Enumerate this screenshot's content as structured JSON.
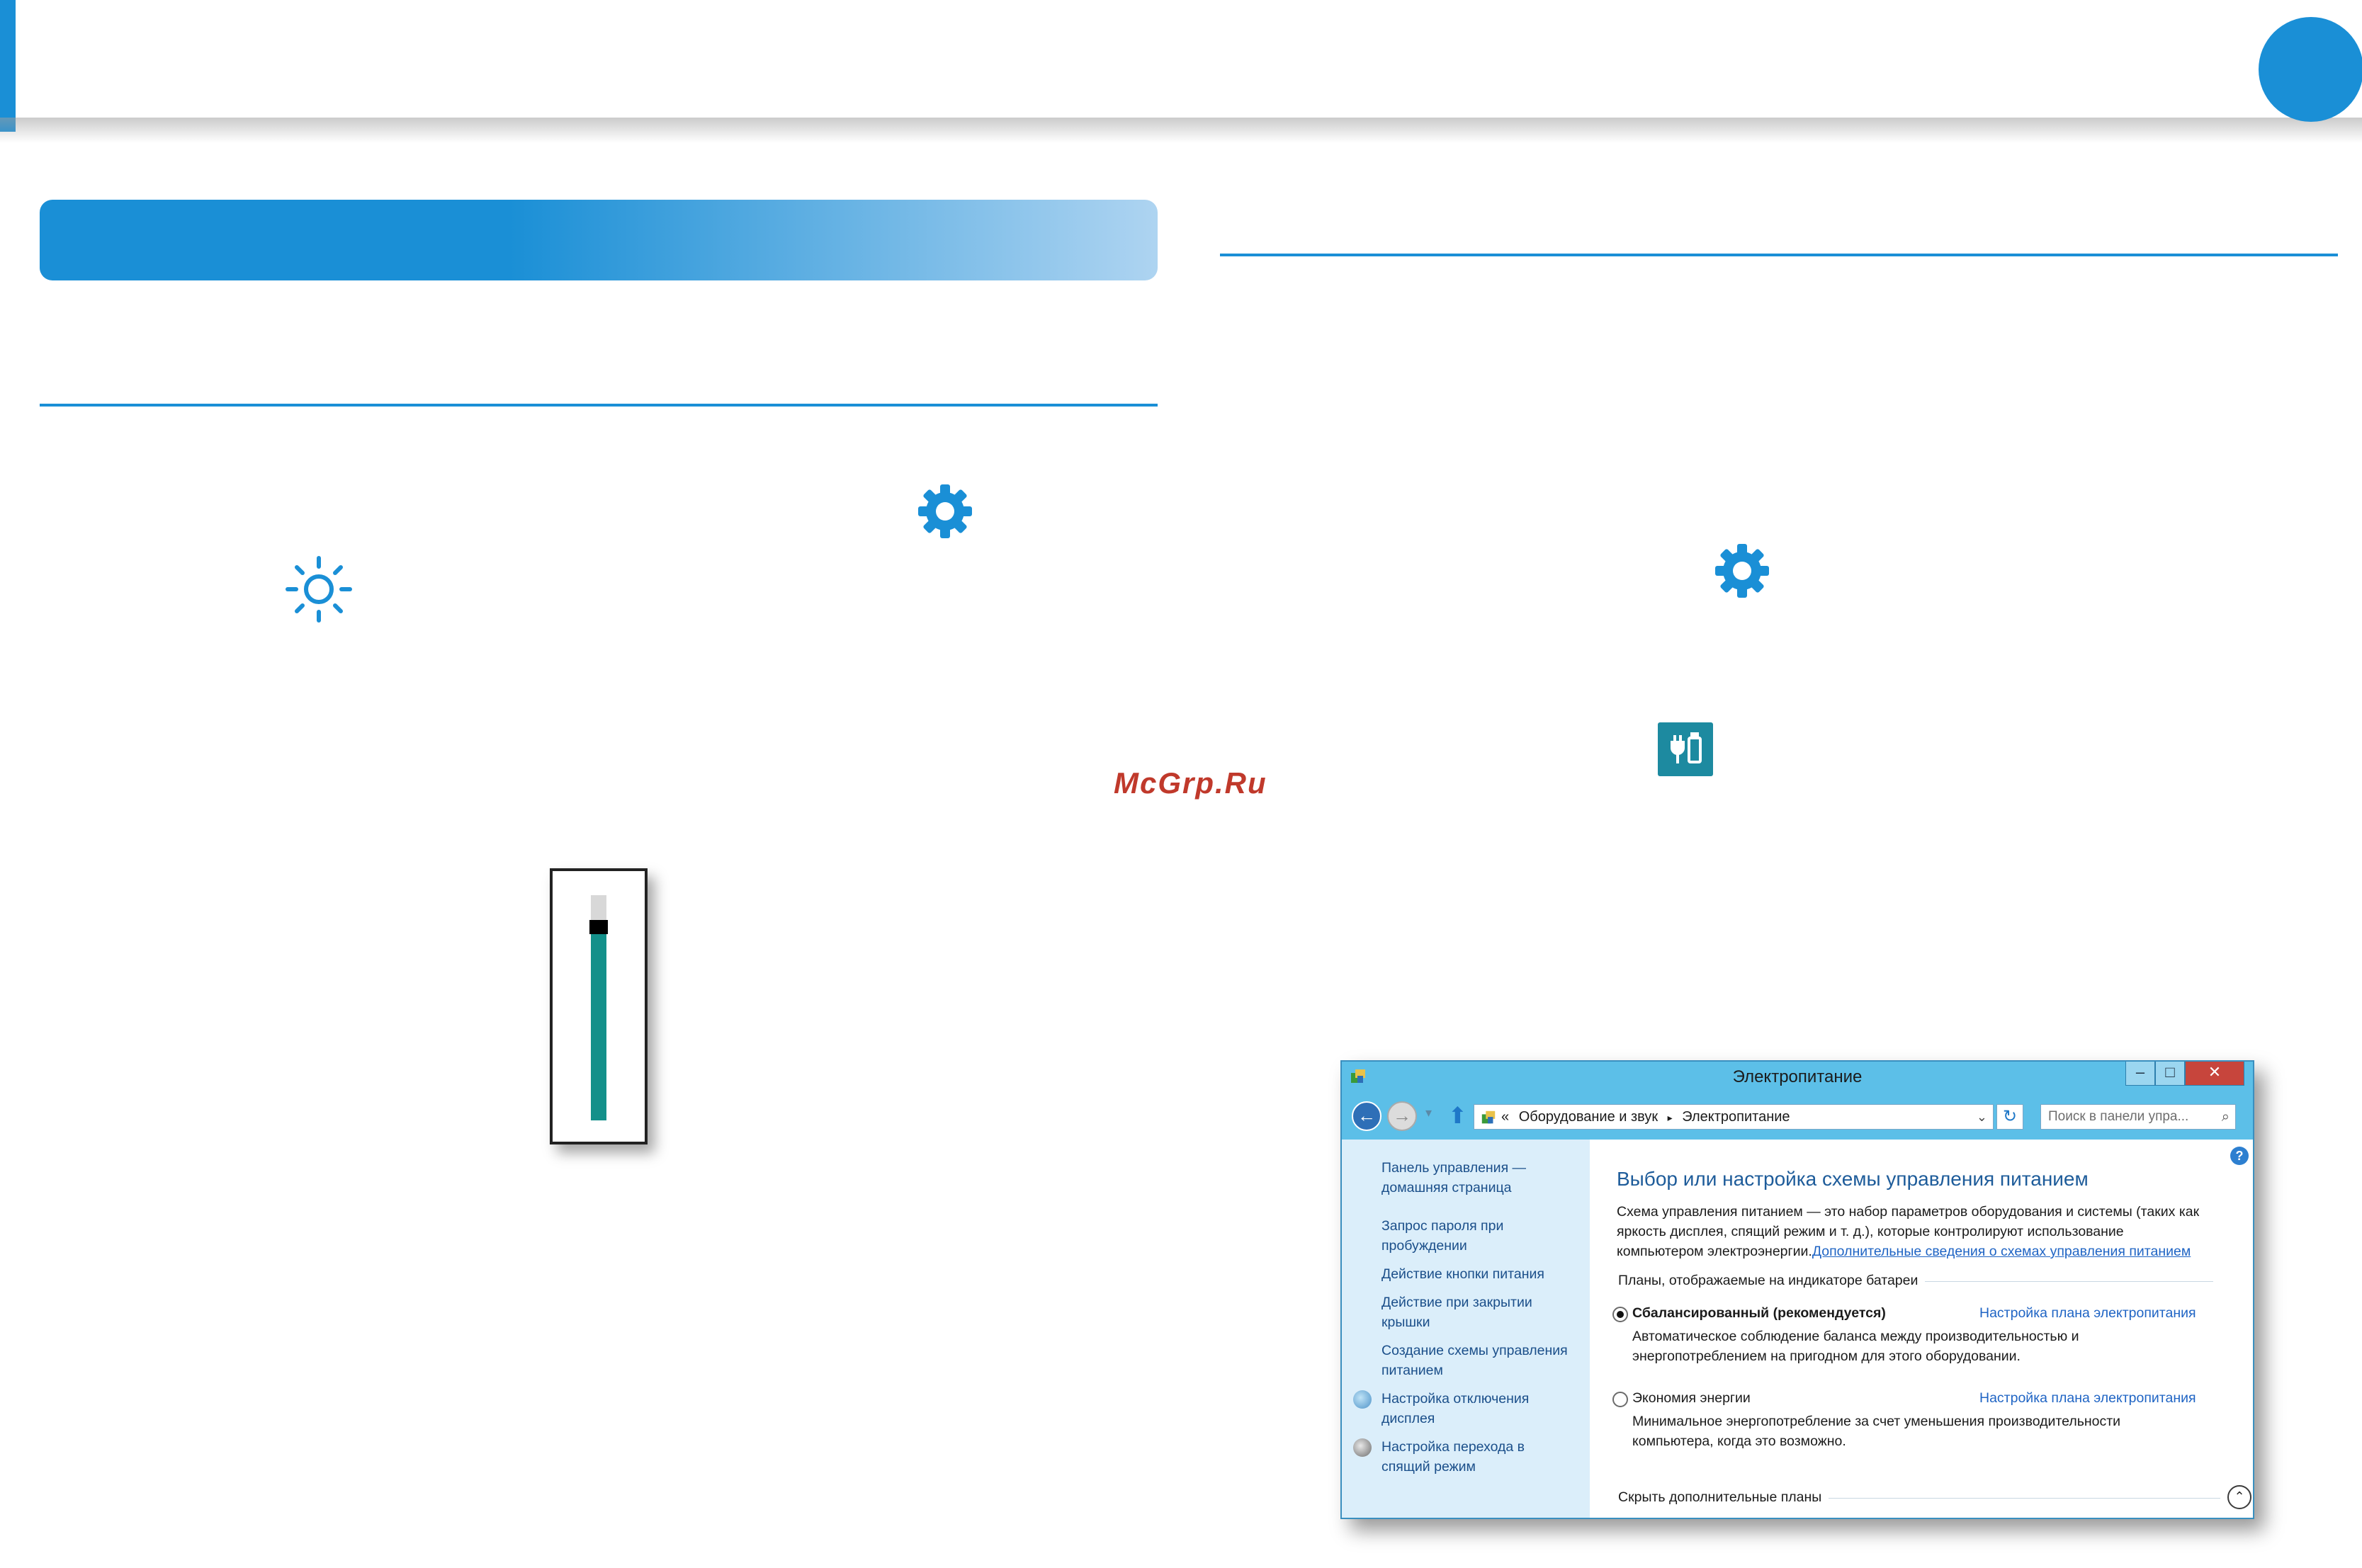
{
  "watermark": "McGrp.Ru",
  "brightness": {
    "level": 0.86
  },
  "dialog": {
    "title": "Электропитание",
    "caption_buttons": {
      "minimize": "–",
      "maximize": "□",
      "close": "✕"
    },
    "nav": {
      "back": "←",
      "forward": "→",
      "recent": "▾",
      "up": "⬆"
    },
    "address": {
      "chevron": "«",
      "path1": "Оборудование и звук",
      "separator": "▸",
      "path2": "Электропитание",
      "dropdown": "⌄"
    },
    "refresh": "↻",
    "search_placeholder": "Поиск в панели упра...",
    "search_icon": "⌕",
    "sidebar": {
      "home_link": [
        "Панель управления —",
        "домашняя страница"
      ],
      "links": [
        [
          "Запрос пароля при",
          "пробуждении"
        ],
        [
          "Действие кнопки питания"
        ],
        [
          "Действие при закрытии",
          "крышки"
        ],
        [
          "Создание схемы управления",
          "питанием"
        ],
        [
          "Настройка отключения",
          "дисплея"
        ],
        [
          "Настройка перехода в",
          "спящий режим"
        ]
      ]
    },
    "main": {
      "heading": "Выбор или настройка схемы управления питанием",
      "desc_line1": "Схема управления питанием — это набор параметров оборудования и системы (таких как",
      "desc_line2": "яркость дисплея, спящий режим и т. д.), которые контролируют использование",
      "desc_line3": "компьютером электроэнергии.",
      "desc_link": "Дополнительные сведения о схемах управления питанием",
      "help": "?",
      "plans_group_label": "Планы, отображаемые на индикаторе батареи",
      "plans": [
        {
          "name": "Сбалансированный (рекомендуется)",
          "selected": true,
          "link": "Настройка плана электропитания",
          "desc1": "Автоматическое соблюдение баланса между производительностью и",
          "desc2": "энергопотреблением на пригодном для этого оборудовании."
        },
        {
          "name": "Экономия энергии",
          "selected": false,
          "link": "Настройка плана электропитания",
          "desc1": "Минимальное энергопотребление за счет уменьшения производительности",
          "desc2": "компьютера, когда это возможно."
        }
      ],
      "hide_plans_label": "Скрыть дополнительные планы",
      "collapse_glyph": "⌃"
    }
  },
  "colors": {
    "accent": "#1a8fd6",
    "slider_fill": "#13908a",
    "battery_tile": "#1d8aa0",
    "watermark": "#c0392b"
  }
}
